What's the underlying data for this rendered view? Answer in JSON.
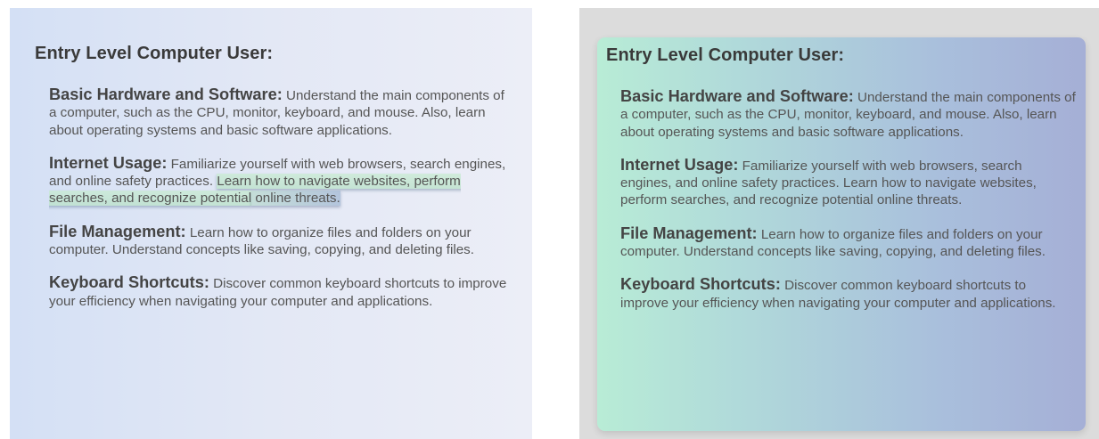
{
  "left_panel": {
    "heading": "Entry Level Computer User:",
    "sections": [
      {
        "term": "Basic Hardware and Software:",
        "text": " Understand the main components of a computer, such as the CPU, monitor, keyboard, and mouse. Also, learn about operating systems and basic software applications."
      },
      {
        "term": "Internet Usage:",
        "text_plain": " Familiarize yourself with web browsers, search engines, and online safety practices. ",
        "text_highlight_1": "Learn how to navigate websites, perform searches, and recognize potential",
        "text_highlight_2": " online threats."
      },
      {
        "term": "File Management:",
        "text": " Learn how to organize files and folders on your computer. Understand concepts like saving, copying, and deleting files."
      },
      {
        "term": "Keyboard Shortcuts:",
        "text": " Discover common keyboard shortcuts to improve your efficiency when navigating your computer and applications."
      }
    ]
  },
  "right_panel": {
    "heading": "Entry Level Computer User:",
    "sections": [
      {
        "term": "Basic Hardware and Software:",
        "text": " Understand the main components of a computer, such as the CPU, monitor, keyboard, and mouse. Also, learn about operating systems and basic software applications."
      },
      {
        "term": "Internet Usage:",
        "text": " Familiarize yourself with web browsers, search engines, and online safety practices. Learn how to navigate websites, perform searches, and recognize potential online threats."
      },
      {
        "term": "File Management:",
        "text": " Learn how to organize files and folders on your computer. Understand concepts like saving, copying, and deleting files."
      },
      {
        "term": "Keyboard Shortcuts:",
        "text": " Discover common keyboard shortcuts to improve your efficiency when navigating your computer and applications."
      }
    ]
  },
  "colors": {
    "left_bg_start": "#d4e0f5",
    "left_bg_end": "#eceef7",
    "right_frame": "#dcdcdc",
    "right_card_start": "#b8ecd6",
    "right_card_end": "#a5afd6",
    "text": "#555555"
  }
}
